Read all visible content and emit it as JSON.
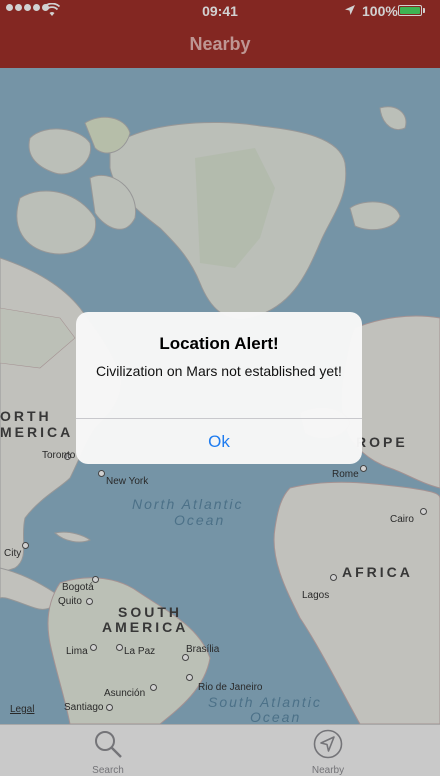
{
  "status_bar": {
    "time": "09:41",
    "battery_percent": "100%",
    "signal_bars": 5
  },
  "nav": {
    "title": "Nearby",
    "bar_color": "#a0302a"
  },
  "map": {
    "legal": "Legal",
    "oceans": [
      {
        "line1": "North Atlantic",
        "line2": "Ocean"
      },
      {
        "line1": "South Atlantic",
        "line2": "Ocean"
      }
    ],
    "regions": [
      {
        "key": "north_america_1",
        "text": "ORTH"
      },
      {
        "key": "north_america_2",
        "text": "MERICA"
      },
      {
        "key": "europe",
        "text": "ROPE"
      },
      {
        "key": "africa",
        "text": "AFRICA"
      },
      {
        "key": "south_america_1",
        "text": "SOUTH"
      },
      {
        "key": "south_america_2",
        "text": "AMERICA"
      }
    ],
    "cities": [
      "Toronto",
      "New York",
      "Rome",
      "Cairo",
      "City",
      "Bogotá",
      "Quito",
      "Lima",
      "La Paz",
      "Brasília",
      "Lagos",
      "Asunción",
      "Rio de Janeiro",
      "Santiago"
    ]
  },
  "alert": {
    "title": "Location Alert!",
    "message": "Civilization on Mars not established yet!",
    "button": "Ok",
    "button_color": "#1e7cf0"
  },
  "tabs": [
    {
      "label": "Search",
      "icon": "magnifier-icon"
    },
    {
      "label": "Nearby",
      "icon": "location-arrow-icon"
    }
  ]
}
